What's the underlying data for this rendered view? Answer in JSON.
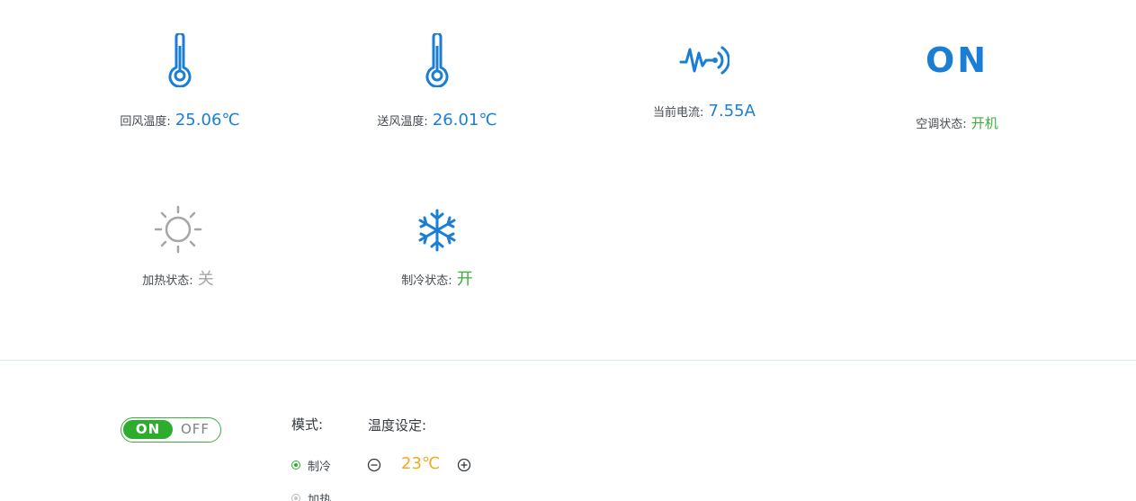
{
  "status": {
    "return_air_temp": {
      "label": "回风温度:",
      "value": "25.06℃",
      "icon": "thermometer-icon"
    },
    "supply_air_temp": {
      "label": "送风温度:",
      "value": "26.01℃",
      "icon": "thermometer-icon"
    },
    "current": {
      "label": "当前电流:",
      "value": "7.55A",
      "icon": "signal-wave-icon"
    },
    "ac_state": {
      "label": "空调状态:",
      "value": "开机",
      "icon_text": "ON"
    },
    "heating_state": {
      "label": "加热状态:",
      "value": "关",
      "icon": "sun-icon"
    },
    "cooling_state": {
      "label": "制冷状态:",
      "value": "开",
      "icon": "snowflake-icon"
    }
  },
  "controls": {
    "power_switch": {
      "on_label": "ON",
      "off_label": "OFF",
      "state": "on"
    },
    "mode": {
      "title": "模式:",
      "options": [
        {
          "label": "制冷",
          "checked": true
        },
        {
          "label": "加热",
          "checked": false
        }
      ]
    },
    "temperature": {
      "title": "温度设定:",
      "value": "23℃"
    }
  },
  "colors": {
    "accent_blue": "#1a7fd4",
    "accent_green": "#3cae3c",
    "muted_gray": "#a6a6a6",
    "setpoint_orange": "#f5a623"
  }
}
